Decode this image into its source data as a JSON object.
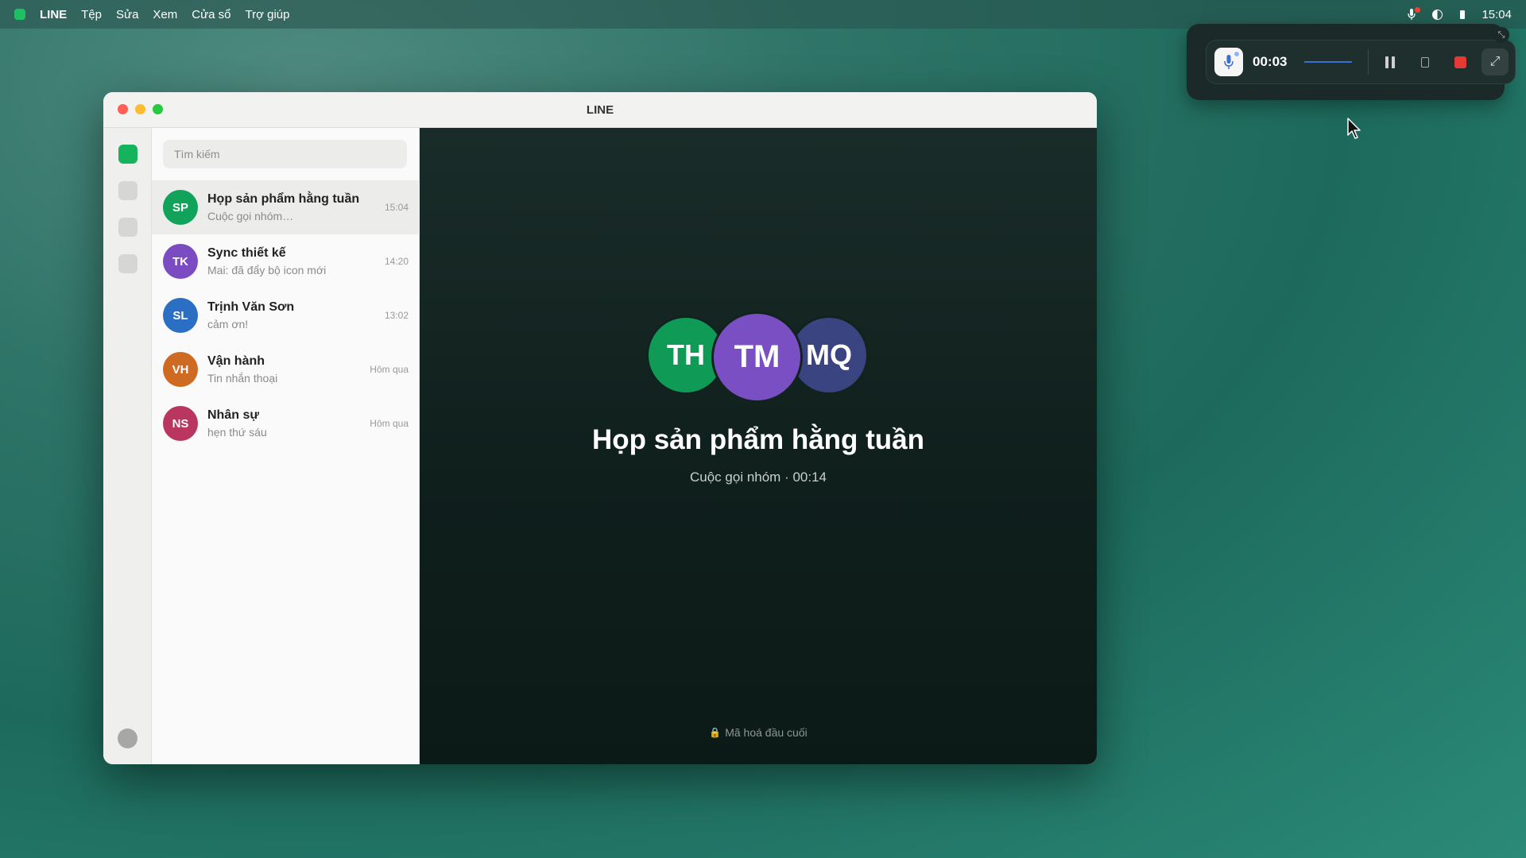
{
  "menubar": {
    "app_name": "LINE",
    "items": [
      "Tệp",
      "Sửa",
      "Xem",
      "Cửa sổ",
      "Trợ giúp"
    ],
    "clock": "15:04",
    "icons": [
      "mic-recording-icon",
      "contrast-icon",
      "battery-icon"
    ]
  },
  "recorder": {
    "time": "00:03",
    "icons": [
      "mic-icon",
      "pause-icon",
      "bookmark-icon",
      "stop-icon",
      "expand-icon"
    ]
  },
  "window": {
    "title": "LINE"
  },
  "search": {
    "placeholder": "Tìm kiếm"
  },
  "chats": [
    {
      "initials": "SP",
      "name": "Họp sản phẩm hằng tuần",
      "preview": "Cuộc gọi nhóm…",
      "time": "15:04",
      "color": "#12a35a"
    },
    {
      "initials": "TK",
      "name": "Sync thiết kế",
      "preview": "Mai: đã đẩy bộ icon mới",
      "time": "14:20",
      "color": "#7b4bc2"
    },
    {
      "initials": "SL",
      "name": "Trịnh Văn Sơn",
      "preview": "cảm ơn!",
      "time": "13:02",
      "color": "#2a6fc4"
    },
    {
      "initials": "VH",
      "name": "Vận hành",
      "preview": "Tin nhắn thoại",
      "time": "Hôm qua",
      "color": "#cf6a22"
    },
    {
      "initials": "NS",
      "name": "Nhân sự",
      "preview": "hẹn thứ sáu",
      "time": "Hôm qua",
      "color": "#b83660"
    }
  ],
  "call": {
    "participants": [
      "TH",
      "TM",
      "MQ"
    ],
    "title": "Họp sản phẩm hằng tuần",
    "subtitle": "Cuộc gọi nhóm · 00:14",
    "encryption": "Mã hoá đầu cuối"
  },
  "colors": {
    "accent": "#16b35d",
    "stop": "#e53935"
  }
}
